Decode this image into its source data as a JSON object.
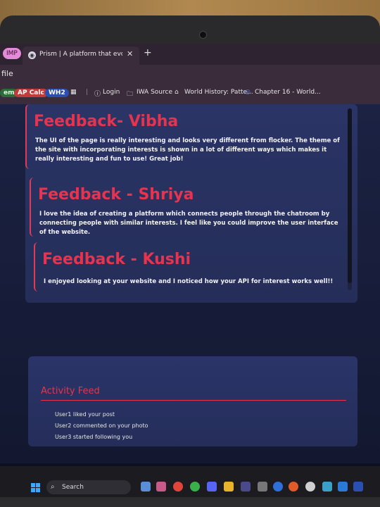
{
  "browser": {
    "pinned_tab": "IMP",
    "active_tab_title": "Prism | A platform that evolves",
    "tab_close": "✕",
    "new_tab": "+",
    "address_fragment": "file",
    "bookmarks": [
      {
        "label": "em"
      },
      {
        "label": "AP Calc"
      },
      {
        "label": "WH2"
      },
      {
        "label": "Login"
      },
      {
        "label": "IWA Source"
      },
      {
        "label": "World History: Patte..."
      },
      {
        "label": "Chapter 16 - World..."
      }
    ]
  },
  "feedback": [
    {
      "title": "Feedback- Vibha",
      "text": "The UI of the page is really interesting and looks very different from flocker. The theme of the site with incorporating interests is shown in a lot of different ways which makes it really interesting and fun to use! Great job!"
    },
    {
      "title": "Feedback - Shriya",
      "text": "I love the idea of creating a platform which connects people through the chatroom by connecting people with similar interests. I feel like you could improve the user interface of the website."
    },
    {
      "title": "Feedback - Kushi",
      "text": "I enjoyed looking at your website and I noticed how your API for interest works well!!"
    }
  ],
  "activity": {
    "title": "Activity Feed",
    "items": [
      "User1 liked your post",
      "User2 commented on your photo",
      "User3 started following you"
    ]
  },
  "taskbar": {
    "search_label": "Search"
  },
  "colors": {
    "accent": "#e8334f",
    "card": "#2a3466"
  }
}
